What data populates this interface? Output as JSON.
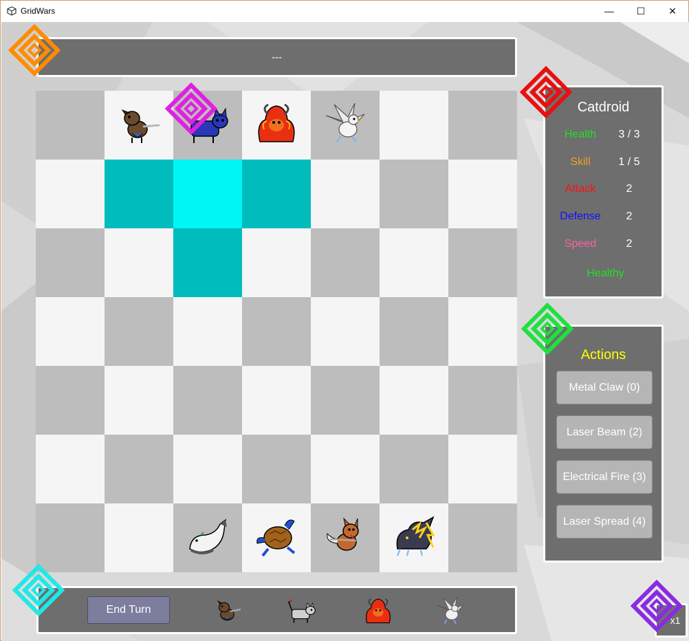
{
  "window": {
    "title": "GridWars",
    "minimize": "—",
    "maximize": "☐",
    "close": "✕"
  },
  "message": "---",
  "selected_unit": {
    "name": "Catdroid",
    "stats": [
      {
        "label": "Health",
        "value": "3 / 3",
        "color": "#22e022"
      },
      {
        "label": "Skill",
        "value": "1 / 5",
        "color": "#f0a020"
      },
      {
        "label": "Attack",
        "value": "2",
        "color": "#ff1010"
      },
      {
        "label": "Defense",
        "value": "2",
        "color": "#1010ff"
      },
      {
        "label": "Speed",
        "value": "2",
        "color": "#ff60a0"
      }
    ],
    "status": "Healthy"
  },
  "actions": {
    "title": "Actions",
    "buttons": [
      "Metal Claw (0)",
      "Laser Beam (2)",
      "Electrical Fire (3)",
      "Laser Spread (4)"
    ]
  },
  "bottom": {
    "end_turn_label": "End Turn",
    "corner_label": "x1"
  },
  "board": {
    "rows": 7,
    "cols": 7,
    "move_cells": [
      [
        1,
        1
      ],
      [
        1,
        3
      ],
      [
        2,
        2
      ]
    ],
    "move_center": [
      1,
      2
    ],
    "units": [
      {
        "row": 0,
        "col": 1,
        "name": "dog-knight-unit"
      },
      {
        "row": 0,
        "col": 2,
        "name": "catdroid-unit"
      },
      {
        "row": 0,
        "col": 3,
        "name": "fire-bull-unit"
      },
      {
        "row": 0,
        "col": 4,
        "name": "griffin-unit"
      },
      {
        "row": 6,
        "col": 2,
        "name": "seal-unit"
      },
      {
        "row": 6,
        "col": 3,
        "name": "turtle-unit"
      },
      {
        "row": 6,
        "col": 4,
        "name": "fox-unit"
      },
      {
        "row": 6,
        "col": 5,
        "name": "thunder-beast-unit"
      }
    ]
  },
  "turn_queue": [
    "dog-knight-unit",
    "robot-cat-unit",
    "fire-bull-unit",
    "griffin-unit"
  ],
  "colors": {
    "marker_orange": "#ff8c00",
    "marker_red": "#e81010",
    "marker_green": "#20e040",
    "marker_cyan": "#20e8e8",
    "marker_purple": "#8a2be2",
    "marker_magenta": "#e020e0"
  }
}
